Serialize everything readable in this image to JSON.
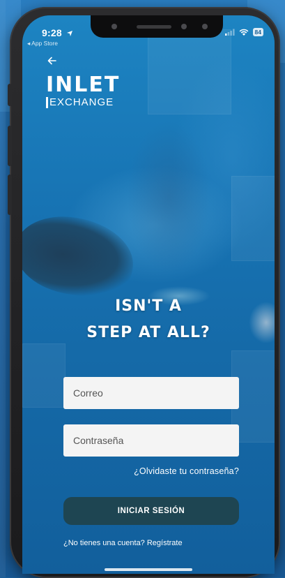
{
  "status_bar": {
    "time": "9:28",
    "back_label": "◂ App Store",
    "battery": "84"
  },
  "logo": {
    "main": "INLET",
    "sub": "EXCHANGE"
  },
  "headline": {
    "line1": "ISN'T A",
    "line2": "STEP AT ALL?"
  },
  "form": {
    "email_placeholder": "Correo",
    "password_placeholder": "Contraseña",
    "forgot_label": "¿Olvidaste tu contraseña?",
    "login_label": "INICIAR SESIÓN",
    "signup_label": "¿No tienes una cuenta? Regístrate"
  },
  "colors": {
    "button_bg": "#1e4552",
    "input_bg": "#f4f4f4",
    "water": "#1773b3"
  },
  "icons": {
    "back": "back-arrow-icon",
    "location": "location-arrow-icon",
    "signal": "signal-icon",
    "wifi": "wifi-icon",
    "battery": "battery-icon"
  }
}
